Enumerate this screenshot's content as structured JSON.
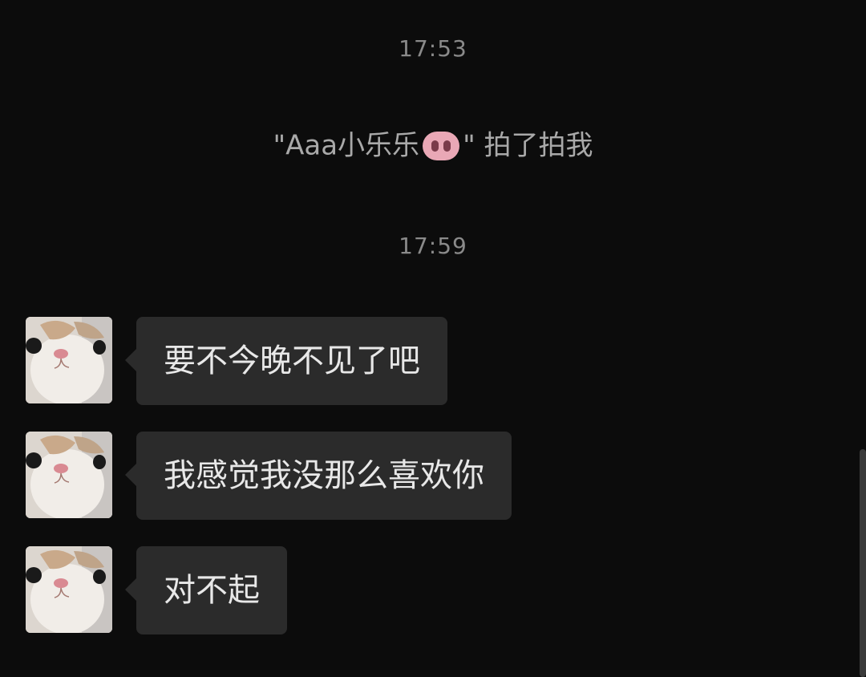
{
  "timestamps": [
    "17:53",
    "17:59"
  ],
  "system_message": {
    "prefix": "\"Aaa小乐乐",
    "icon": "pig-nose-icon",
    "suffix": "\" 拍了拍我"
  },
  "messages": [
    {
      "text": "要不今晚不见了吧",
      "avatar": "cat-avatar-icon"
    },
    {
      "text": "我感觉我没那么喜欢你",
      "avatar": "cat-avatar-icon"
    },
    {
      "text": "对不起",
      "avatar": "cat-avatar-icon"
    }
  ],
  "colors": {
    "background": "#0c0c0c",
    "bubble": "#2b2b2b",
    "text": "#e8e8e8",
    "timestamp": "#8a8a8a"
  }
}
